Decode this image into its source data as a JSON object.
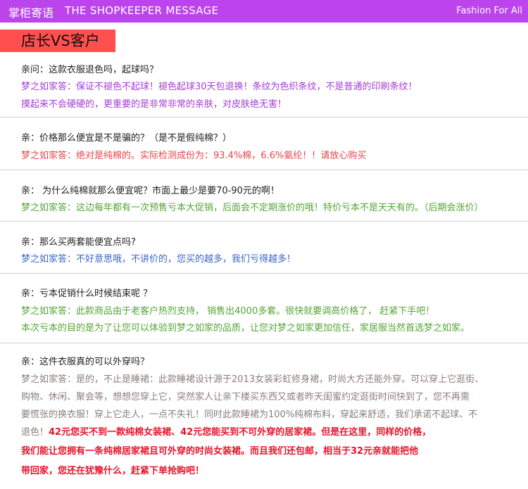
{
  "header": {
    "title_cn": "掌柜寄语",
    "title_en": "THE SHOPKEEPER MESSAGE",
    "tagline": "Fashion For All"
  },
  "badge": "店长VS客户",
  "qa": [
    {
      "q": "亲问：这款衣服退色吗，起球吗？",
      "a": [
        "梦之如家答：保证不褪色不起球！褪色起球30天包退换！条纹为色织条纹，不是普通的印刷条纹！",
        "摸起来不会硬硬的，更重要的是非常非常的亲肤，对皮肤绝无害！"
      ]
    },
    {
      "q": "亲：价格那么便宜是不是骗的？（是不是假纯棉？）",
      "a": [
        "梦之如家答：绝对是纯棉的。实际检测成份为：93.4%棉，6.6%氨纶！！请放心购买"
      ]
    },
    {
      "q": "亲：  为什么纯棉就那么便宜呢？市面上最少是要70-90元的啊！",
      "a": [
        "梦之如家答：这边每年都有一次预售亏本大促销，后面会不定期涨价的哦！特价亏本不是天天有的。（后期会涨价）"
      ]
    },
    {
      "q": "亲：那么买两套能便宜点吗?",
      "a": [
        "梦之如家答：不好意思哦，不讲价的，您买的越多，我们亏得越多！"
      ]
    },
    {
      "q": "亲：亏本促销什么时候结束呢 ？",
      "a": [
        "梦之如家答：此款商品由于老客户热烈支持， 销售出4000多套。很快就要调高价格了， 赶紧下手吧！",
        "本次亏本的目的是为了让您可以体验到梦之如家的品质，让您对梦之如家更加信任，家居服当然首选梦之如家。"
      ]
    },
    {
      "q": "亲：这件衣服真的可以外穿吗？",
      "a": [
        "梦之如家答：是的，不止是睡裙：此款睡裙设计源于2013女装彩虹修身裙，时尚大方还能外穿。可以穿上它逛街、",
        "购物、休闲、聚会等，想想您穿上它，突然家人让亲下楼买东西又或者昨天闺蜜约定逛街时间快到了，您不再需",
        "要慌张的换衣服！穿上它走人，一点不失礼！同时此款睡裙为100%纯棉布料，穿起来舒适，我们承诺不起球、不"
      ],
      "a_mixed_prefix": "退色！",
      "a_mixed_bold": "42元您买不到一款纯棉女装裙、42元您能买到不可外穿的居家裙。但是在这里，同样的价格，",
      "a_bold": [
        "我们能让您拥有一条纯棉居家裙且可外穿的时尚女装裙。而且我们还包邮，相当于32元亲就能把他",
        "带回家，您还在犹豫什么，赶紧下单抢购吧！"
      ]
    }
  ]
}
